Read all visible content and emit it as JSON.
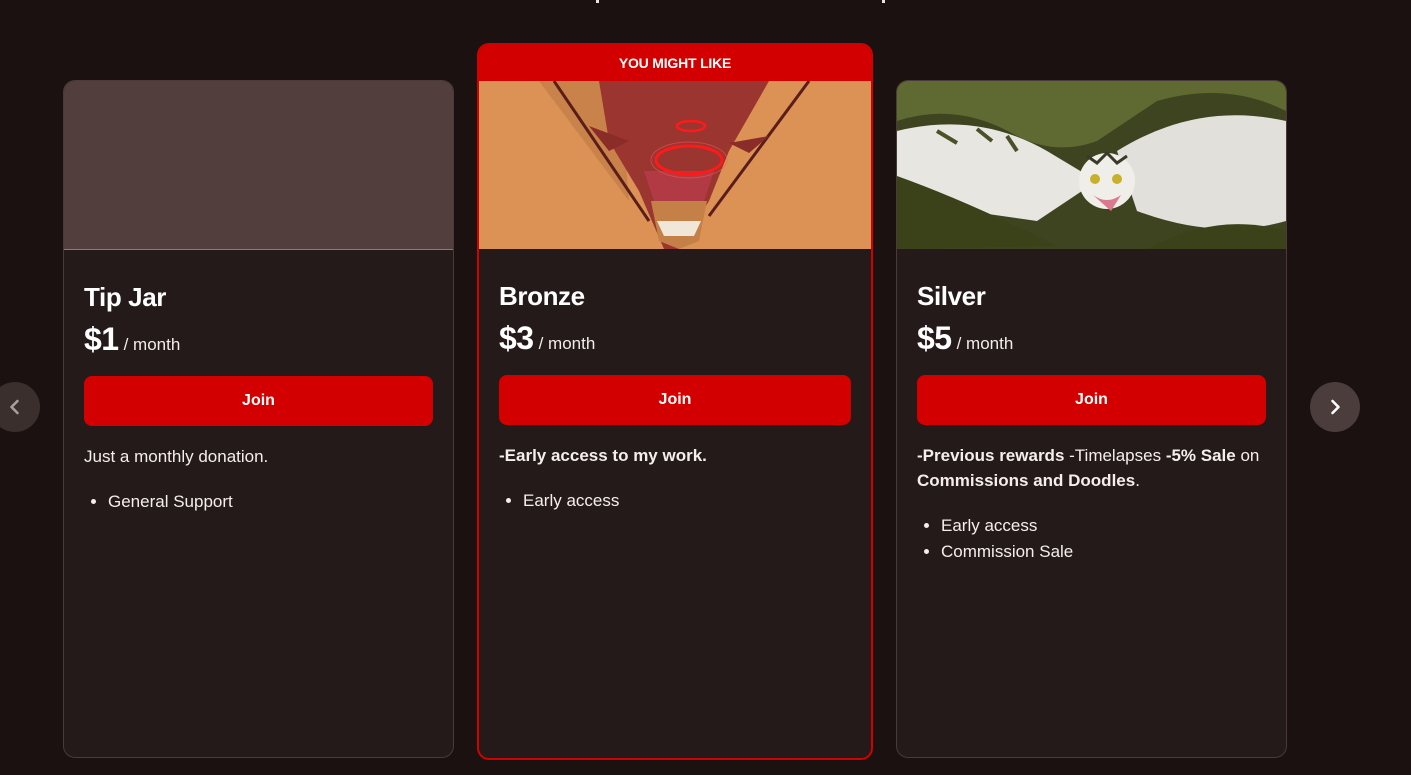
{
  "tiers": [
    {
      "name": "Tip Jar",
      "price": "$1",
      "period": "/ month",
      "join_label": "Join",
      "description": "Just a monthly donation.",
      "perks": [
        "General Support"
      ]
    },
    {
      "banner": "YOU MIGHT LIKE",
      "name": "Bronze",
      "price": "$3",
      "period": "/ month",
      "join_label": "Join",
      "description": "-Early access to my work.",
      "perks": [
        "Early access"
      ]
    },
    {
      "name": "Silver",
      "price": "$5",
      "period": "/ month",
      "join_label": "Join",
      "description_parts": {
        "p1": "-Previous rewards",
        "p2": " -Timelapses ",
        "p3": "-5% Sale",
        "p4": " on ",
        "p5": "Commissions and Doodles",
        "p6": "."
      },
      "perks": [
        "Early access",
        "Commission Sale"
      ]
    }
  ],
  "nav": {
    "prev_icon": "chevron-left-icon",
    "next_icon": "chevron-right-icon"
  },
  "colors": {
    "accent": "#d30000",
    "background": "#1a1110",
    "card": "#241a19",
    "tip_jar_image": "#523e3c"
  }
}
